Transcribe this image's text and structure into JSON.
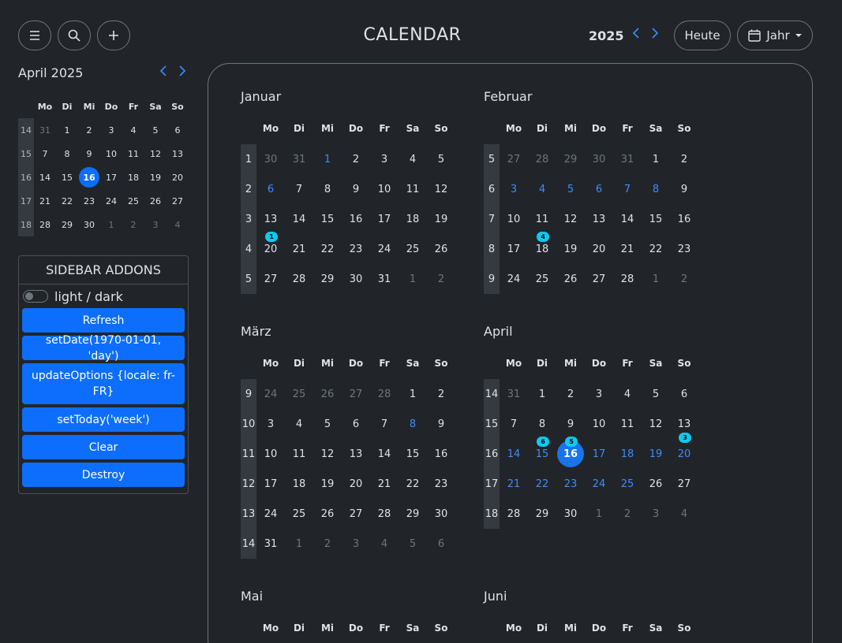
{
  "toolbar": {
    "title": "CALENDAR",
    "year": "2025",
    "today_label": "Heute",
    "view_label": "Jahr",
    "icons": [
      "menu-icon",
      "search-icon",
      "plus-icon",
      "chevron-left-icon",
      "chevron-right-icon",
      "calendar-icon",
      "caret-down-icon"
    ]
  },
  "mini_calendar": {
    "title": "April 2025",
    "weekdays": [
      "Mo",
      "Di",
      "Mi",
      "Do",
      "Fr",
      "Sa",
      "So"
    ],
    "weeks": [
      {
        "wk": "14",
        "days": [
          "31",
          "1",
          "2",
          "3",
          "4",
          "5",
          "6"
        ],
        "dim": [
          0
        ]
      },
      {
        "wk": "15",
        "days": [
          "7",
          "8",
          "9",
          "10",
          "11",
          "12",
          "13"
        ],
        "dim": []
      },
      {
        "wk": "16",
        "days": [
          "14",
          "15",
          "16",
          "17",
          "18",
          "19",
          "20"
        ],
        "dim": []
      },
      {
        "wk": "17",
        "days": [
          "21",
          "22",
          "23",
          "24",
          "25",
          "26",
          "27"
        ],
        "dim": []
      },
      {
        "wk": "18",
        "days": [
          "28",
          "29",
          "30",
          "1",
          "2",
          "3",
          "4"
        ],
        "dim": [
          3,
          4,
          5,
          6
        ]
      }
    ],
    "today": {
      "week": 2,
      "day": 2
    }
  },
  "sidebar_addons": {
    "title": "SIDEBAR ADDONS",
    "toggle_label": "light / dark",
    "buttons": [
      "Refresh",
      "setDate(1970-01-01, 'day')",
      "updateOptions {locale: fr-FR}",
      "setToday('week')",
      "Clear",
      "Destroy"
    ]
  },
  "year_view": {
    "weekdays": [
      "Mo",
      "Di",
      "Mi",
      "Do",
      "Fr",
      "Sa",
      "So"
    ],
    "months": [
      {
        "name": "Januar",
        "weeks": [
          {
            "wk": "1",
            "days": [
              "30",
              "31",
              "1",
              "2",
              "3",
              "4",
              "5"
            ],
            "dim": [
              0,
              1
            ],
            "hl": [
              2
            ]
          },
          {
            "wk": "2",
            "days": [
              "6",
              "7",
              "8",
              "9",
              "10",
              "11",
              "12"
            ],
            "dim": [],
            "hl": [
              0
            ]
          },
          {
            "wk": "3",
            "days": [
              "13",
              "14",
              "15",
              "16",
              "17",
              "18",
              "19"
            ],
            "dim": [],
            "hl": [],
            "badges": [
              {
                "day": 0,
                "count": "1"
              }
            ]
          },
          {
            "wk": "4",
            "days": [
              "20",
              "21",
              "22",
              "23",
              "24",
              "25",
              "26"
            ],
            "dim": [],
            "hl": []
          },
          {
            "wk": "5",
            "days": [
              "27",
              "28",
              "29",
              "30",
              "31",
              "1",
              "2"
            ],
            "dim": [
              5,
              6
            ],
            "hl": []
          }
        ]
      },
      {
        "name": "Februar",
        "weeks": [
          {
            "wk": "5",
            "days": [
              "27",
              "28",
              "29",
              "30",
              "31",
              "1",
              "2"
            ],
            "dim": [
              0,
              1,
              2,
              3,
              4
            ],
            "hl": []
          },
          {
            "wk": "6",
            "days": [
              "3",
              "4",
              "5",
              "6",
              "7",
              "8",
              "9"
            ],
            "dim": [],
            "hl": [
              0,
              1,
              2,
              3,
              4,
              5
            ]
          },
          {
            "wk": "7",
            "days": [
              "10",
              "11",
              "12",
              "13",
              "14",
              "15",
              "16"
            ],
            "dim": [],
            "hl": [],
            "badges": [
              {
                "day": 1,
                "count": "4"
              }
            ]
          },
          {
            "wk": "8",
            "days": [
              "17",
              "18",
              "19",
              "20",
              "21",
              "22",
              "23"
            ],
            "dim": [],
            "hl": []
          },
          {
            "wk": "9",
            "days": [
              "24",
              "25",
              "26",
              "27",
              "28",
              "1",
              "2"
            ],
            "dim": [
              5,
              6
            ],
            "hl": []
          }
        ]
      },
      {
        "name": "März",
        "weeks": [
          {
            "wk": "9",
            "days": [
              "24",
              "25",
              "26",
              "27",
              "28",
              "1",
              "2"
            ],
            "dim": [
              0,
              1,
              2,
              3,
              4
            ],
            "hl": []
          },
          {
            "wk": "10",
            "days": [
              "3",
              "4",
              "5",
              "6",
              "7",
              "8",
              "9"
            ],
            "dim": [],
            "hl": [
              5
            ]
          },
          {
            "wk": "11",
            "days": [
              "10",
              "11",
              "12",
              "13",
              "14",
              "15",
              "16"
            ],
            "dim": [],
            "hl": []
          },
          {
            "wk": "12",
            "days": [
              "17",
              "18",
              "19",
              "20",
              "21",
              "22",
              "23"
            ],
            "dim": [],
            "hl": []
          },
          {
            "wk": "13",
            "days": [
              "24",
              "25",
              "26",
              "27",
              "28",
              "29",
              "30"
            ],
            "dim": [],
            "hl": []
          },
          {
            "wk": "14",
            "days": [
              "31",
              "1",
              "2",
              "3",
              "4",
              "5",
              "6"
            ],
            "dim": [
              1,
              2,
              3,
              4,
              5,
              6
            ],
            "hl": []
          }
        ]
      },
      {
        "name": "April",
        "weeks": [
          {
            "wk": "14",
            "days": [
              "31",
              "1",
              "2",
              "3",
              "4",
              "5",
              "6"
            ],
            "dim": [
              0
            ],
            "hl": []
          },
          {
            "wk": "15",
            "days": [
              "7",
              "8",
              "9",
              "10",
              "11",
              "12",
              "13"
            ],
            "dim": [],
            "hl": [],
            "badges": [
              {
                "day": 1,
                "count": "6"
              },
              {
                "day": 2,
                "count": "5"
              },
              {
                "day": 6,
                "count": "3",
                "next": true
              }
            ]
          },
          {
            "wk": "16",
            "days": [
              "14",
              "15",
              "16",
              "17",
              "18",
              "19",
              "20"
            ],
            "dim": [],
            "hl": [
              0,
              1,
              3,
              4,
              5,
              6
            ],
            "today": 2
          },
          {
            "wk": "17",
            "days": [
              "21",
              "22",
              "23",
              "24",
              "25",
              "26",
              "27"
            ],
            "dim": [],
            "hl": [
              0,
              1,
              2,
              3,
              4
            ]
          },
          {
            "wk": "18",
            "days": [
              "28",
              "29",
              "30",
              "1",
              "2",
              "3",
              "4"
            ],
            "dim": [
              3,
              4,
              5,
              6
            ],
            "hl": []
          }
        ]
      },
      {
        "name": "Mai",
        "weeks": []
      },
      {
        "name": "Juni",
        "weeks": []
      }
    ]
  }
}
